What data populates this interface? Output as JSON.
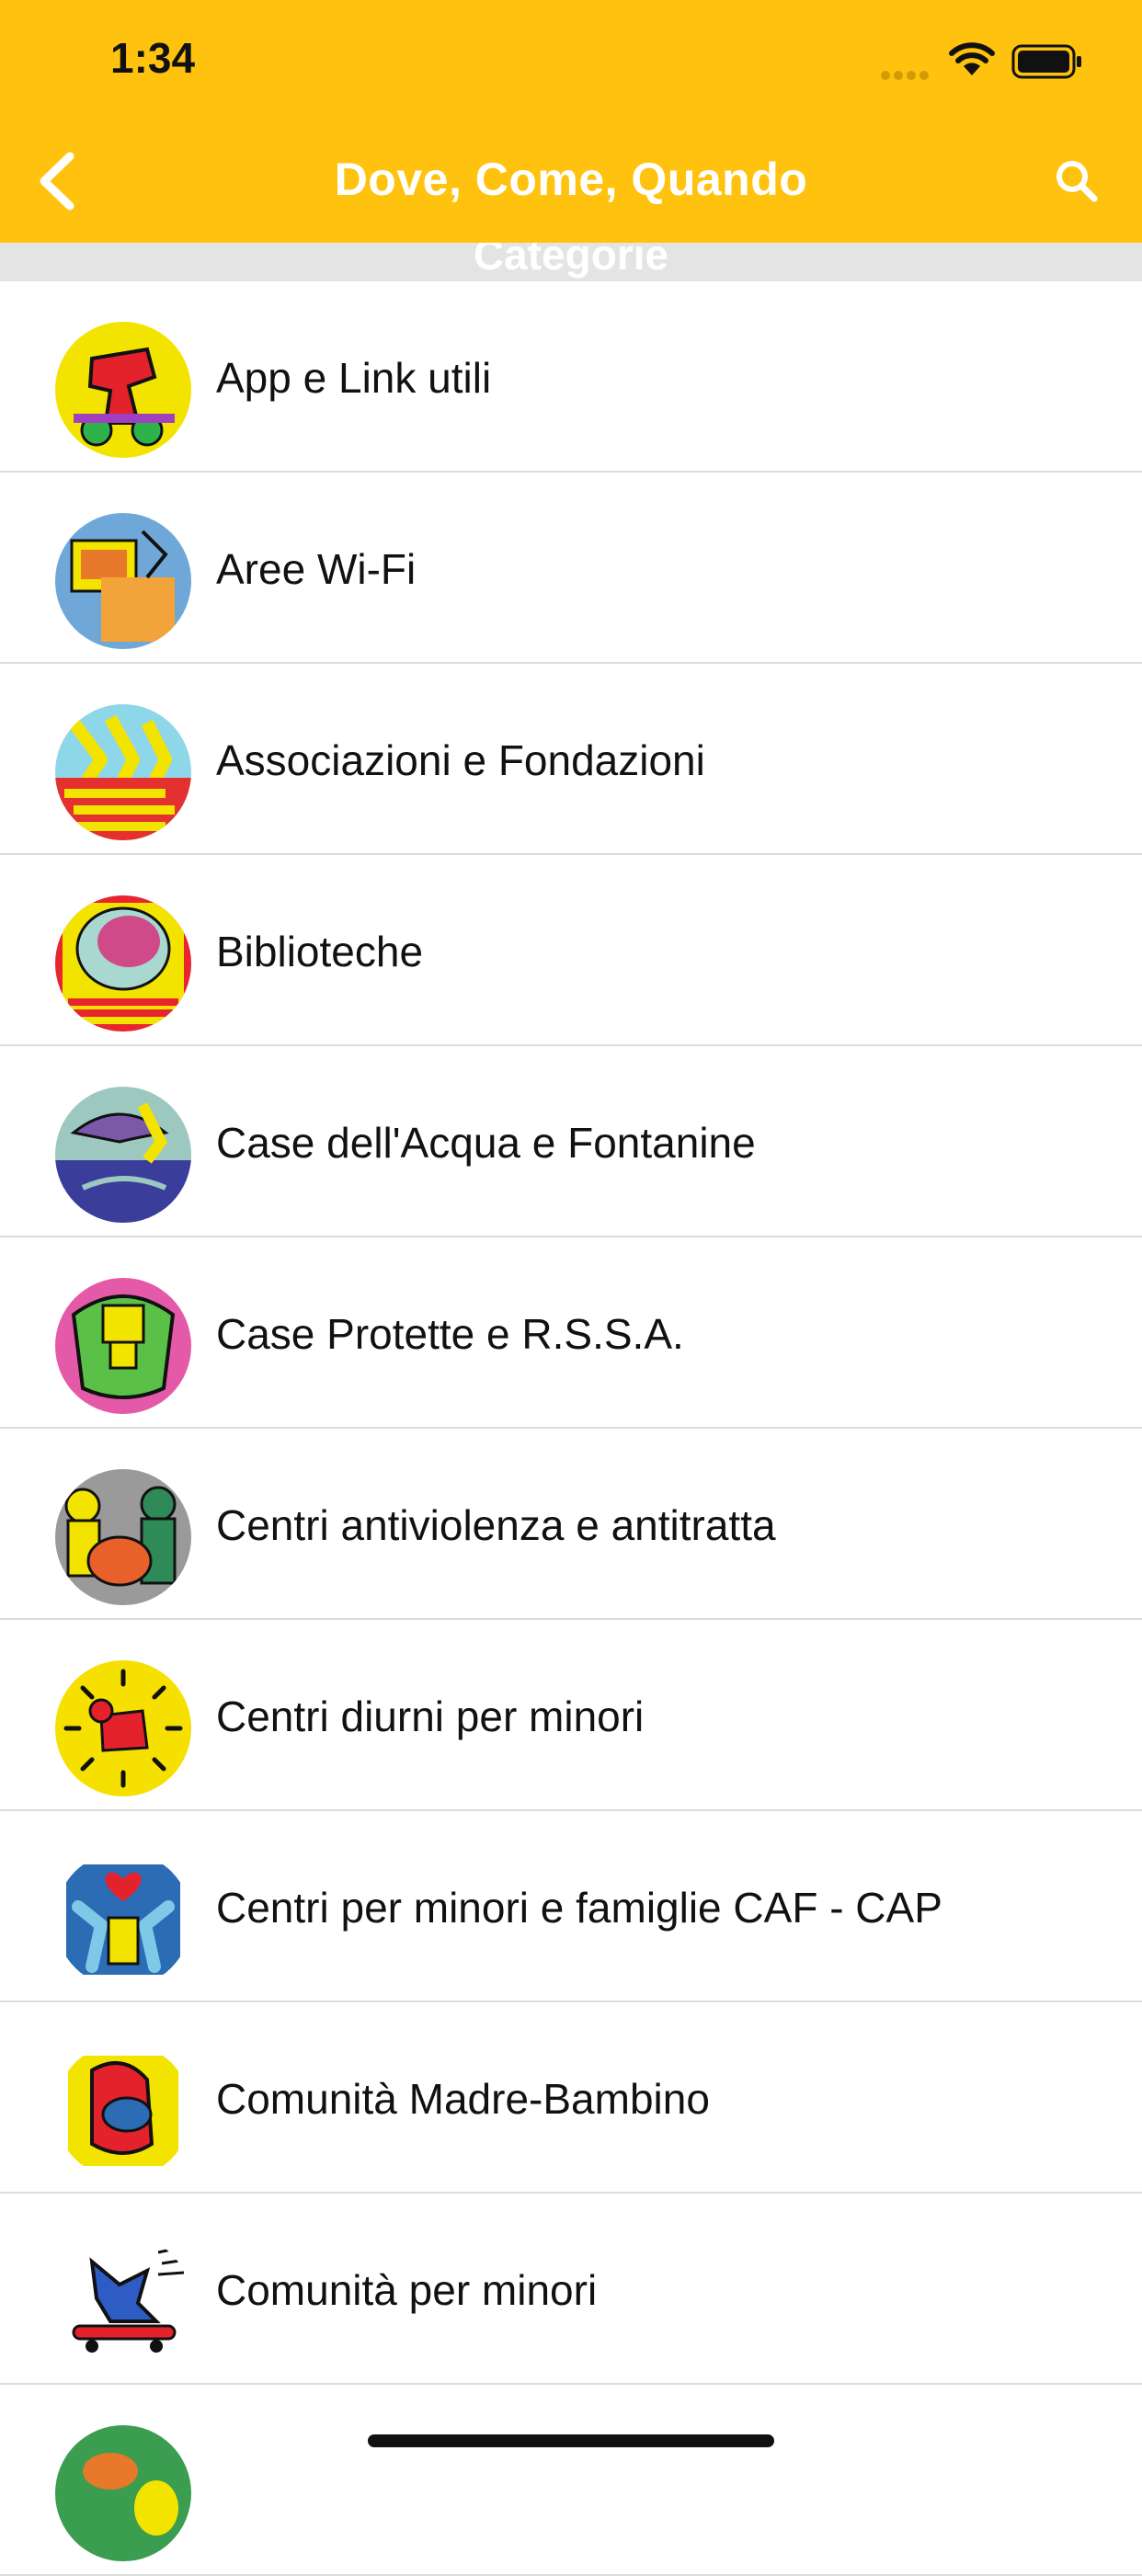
{
  "status": {
    "time": "1:34"
  },
  "nav": {
    "title": "Dove, Come, Quando"
  },
  "section": {
    "label": "Categorie"
  },
  "items": [
    {
      "label": "App e Link utili",
      "icon": "dog-dj-icon",
      "color": "#F3E400"
    },
    {
      "label": "Aree Wi-Fi",
      "icon": "computer-icon",
      "color": "#6FA8D8"
    },
    {
      "label": "Associazioni e Fondazioni",
      "icon": "peace-march-icon",
      "color": "#E53030"
    },
    {
      "label": "Biblioteche",
      "icon": "brain-head-icon",
      "color": "#E8242E"
    },
    {
      "label": "Case dell'Acqua e Fontanine",
      "icon": "dolphin-icon",
      "color": "#3B3D9B"
    },
    {
      "label": "Case Protette e R.S.S.A.",
      "icon": "hugging-figures-icon",
      "color": "#E45AA8"
    },
    {
      "label": "Centri antiviolenza e antitratta",
      "icon": "three-figures-icon",
      "color": "#2E8B57"
    },
    {
      "label": "Centri diurni per minori",
      "icon": "radiant-baby-icon",
      "color": "#F5E000"
    },
    {
      "label": "Centri per minori e famiglie CAF - CAP",
      "icon": "heart-figures-icon",
      "color": "#2B6CB5"
    },
    {
      "label": "Comunità Madre-Bambino",
      "icon": "mother-child-icon",
      "color": "#F3E400"
    },
    {
      "label": "Comunità per minori",
      "icon": "skateboarder-icon",
      "color": "#2E5CC5"
    },
    {
      "label": "",
      "icon": "globe-icon",
      "color": "#3A9D4F"
    }
  ]
}
